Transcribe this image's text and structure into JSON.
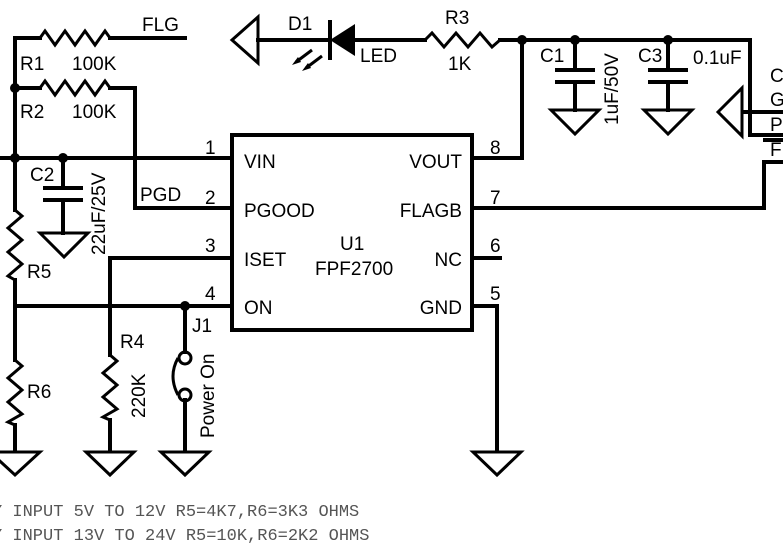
{
  "components": {
    "r1": {
      "ref": "R1",
      "value": "100K"
    },
    "r2": {
      "ref": "R2",
      "value": "100K"
    },
    "r3": {
      "ref": "R3",
      "value": "1K"
    },
    "r4": {
      "ref": "R4",
      "value": "220K"
    },
    "r5": {
      "ref": "R5"
    },
    "r6": {
      "ref": "R6"
    },
    "c1": {
      "ref": "C1",
      "value": "1uF/50V"
    },
    "c2": {
      "ref": "C2",
      "value": "22uF/25V"
    },
    "c3": {
      "ref": "C3",
      "value": "0.1uF"
    },
    "d1": {
      "ref": "D1",
      "value": "LED"
    },
    "j1": {
      "ref": "J1",
      "value": "Power On"
    },
    "u1": {
      "ref": "U1",
      "value": "FPF2700"
    }
  },
  "nets": {
    "flg": "FLG",
    "pgd": "PGD"
  },
  "pins": {
    "p1": {
      "num": "1",
      "name": "VIN"
    },
    "p2": {
      "num": "2",
      "name": "PGOOD"
    },
    "p3": {
      "num": "3",
      "name": "ISET"
    },
    "p4": {
      "num": "4",
      "name": "ON"
    },
    "p5": {
      "num": "5",
      "name": "GND"
    },
    "p6": {
      "num": "6",
      "name": "NC"
    },
    "p7": {
      "num": "7",
      "name": "FLAGB"
    },
    "p8": {
      "num": "8",
      "name": "VOUT"
    }
  },
  "right_edge_fragments": [
    "C",
    "G",
    "P",
    "F"
  ],
  "notes": [
    "Y INPUT 5V TO 12V R5=4K7,R6=3K3 OHMS",
    "Y INPUT 13V TO 24V R5=10K,R6=2K2 OHMS"
  ]
}
